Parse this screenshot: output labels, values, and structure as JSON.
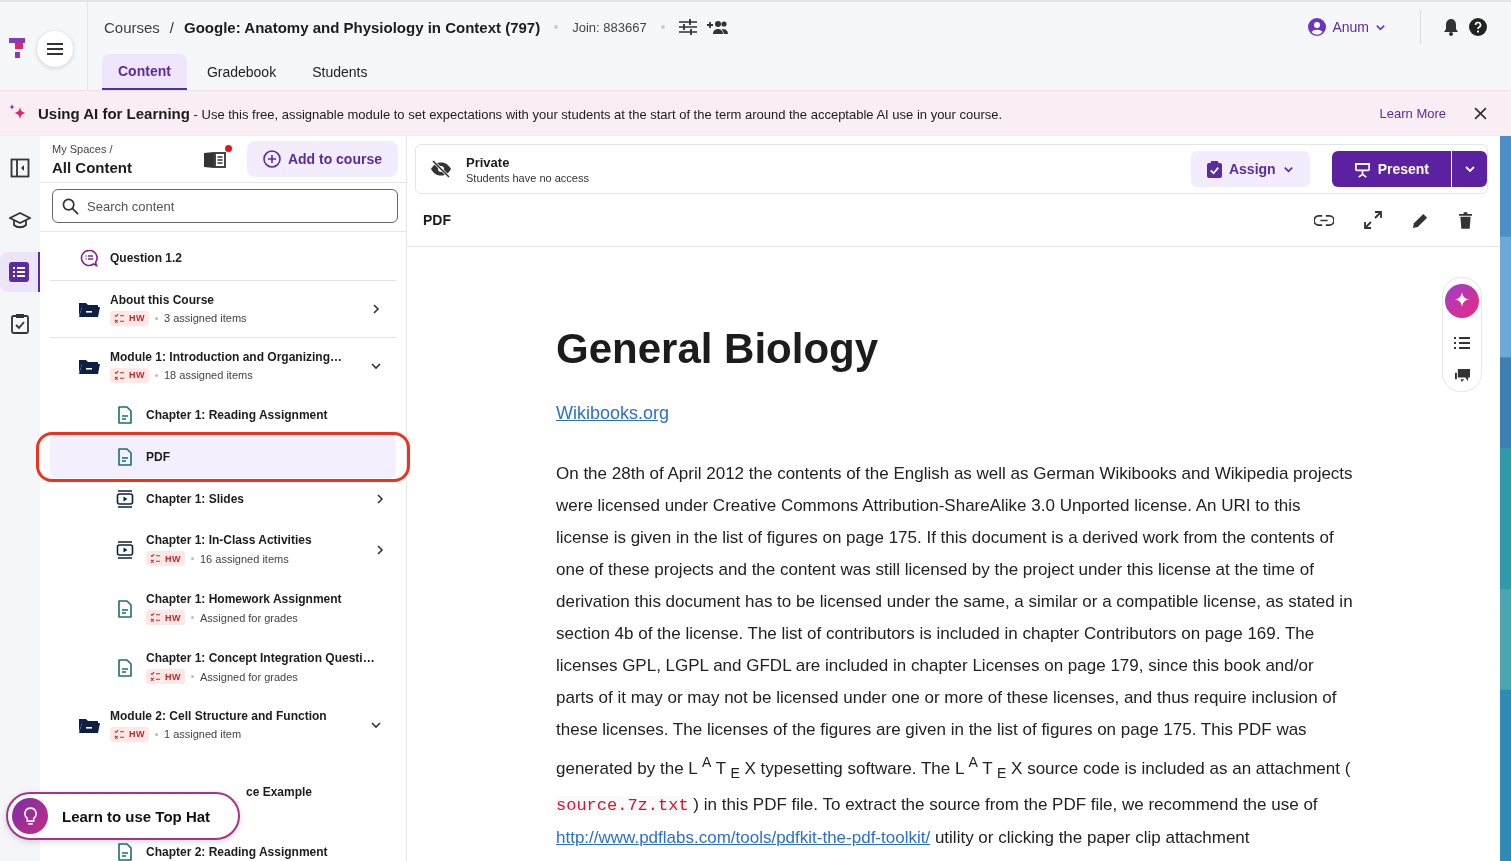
{
  "course": {
    "parent": "Courses",
    "separator": "/",
    "title": "Google: Anatomy and Physiology in Context (797)",
    "join": "Join: 883667"
  },
  "user": {
    "name": "Anum"
  },
  "tabs": [
    {
      "label": "Content",
      "selected": true
    },
    {
      "label": "Gradebook",
      "selected": false
    },
    {
      "label": "Students",
      "selected": false
    }
  ],
  "banner": {
    "title": "Using AI for Learning",
    "text": "- Use this free, assignable module to set expectations with your students at the start of the term around the acceptable AI use in your course.",
    "link": "Learn More"
  },
  "rail": [
    {
      "kind": "collapse",
      "selected": false
    },
    {
      "kind": "course",
      "selected": false
    },
    {
      "kind": "content",
      "selected": true
    },
    {
      "kind": "assign",
      "selected": false
    }
  ],
  "sidebar": {
    "crumb": "My Spaces /",
    "title": "All Content",
    "notification": true,
    "add_button": "Add to course",
    "search": {
      "placeholder": "Search content"
    },
    "items": [
      {
        "kind": "question",
        "title": "Question 1.2",
        "selected": false,
        "annotated": false
      },
      {
        "kind": "folder",
        "title": "About this Course",
        "badge": "HW",
        "meta": "3 assigned items",
        "expanded": false,
        "selected": false,
        "annotated": false
      },
      {
        "kind": "folder",
        "title": "Module 1: Introduction and Organizing…",
        "badge": "HW",
        "meta": "18 assigned items",
        "expanded": true,
        "selected": false,
        "annotated": false,
        "children": [
          {
            "kind": "doc",
            "title": "Chapter 1: Reading Assignment",
            "selected": false,
            "annotated": false
          },
          {
            "kind": "doc",
            "title": "PDF",
            "selected": true,
            "annotated": true
          },
          {
            "kind": "slides",
            "title": "Chapter 1: Slides",
            "expanded": false,
            "selected": false,
            "annotated": false
          },
          {
            "kind": "slides",
            "title": "Chapter 1: In-Class Activities",
            "badge": "HW",
            "meta": "16 assigned items",
            "expanded": false,
            "selected": false,
            "annotated": false
          },
          {
            "kind": "doc",
            "title": "Chapter 1: Homework Assignment",
            "badge": "HW",
            "meta": "Assigned for grades",
            "selected": false,
            "annotated": false
          },
          {
            "kind": "doc",
            "title": "Chapter 1: Concept Integration Questi…",
            "badge": "HW",
            "meta": "Assigned for grades",
            "selected": false,
            "annotated": false
          }
        ]
      },
      {
        "kind": "folder",
        "title": "Module 2: Cell Structure and Function",
        "badge": "HW",
        "meta": "1 assigned item",
        "expanded": true,
        "selected": false,
        "annotated": false,
        "children": [
          {
            "title": "ce Example",
            "covered": true,
            "selected": false,
            "annotated": false
          },
          {
            "kind": "doc",
            "title": "Chapter 2: Reading Assignment",
            "selected": false,
            "annotated": false
          }
        ]
      }
    ]
  },
  "visibility": {
    "title": "Private",
    "subtitle": "Students have no access"
  },
  "assign_button": "Assign",
  "present_button": "Present",
  "document_header": "PDF",
  "document": {
    "title": "General Biology",
    "source_link": "Wikibooks.org",
    "paragraph": "On the 28th of April 2012 the contents of the English as well as German Wikibooks and Wikipedia projects were licensed under Creative Commons Attribution-ShareAlike 3.0 Unported license. An URI to this license is given in the list of figures on page 175. If this document is a derived work from the contents of one of these projects and the content was still licensed by the project under this license at the time of derivation this document has to be licensed under the same, a similar or a compatible license, as stated in section 4b of the license. The list of contributors is included in chapter Contributors on page 169. The licenses GPL, LGPL and GFDL are included in chapter Licenses on page 179, since this book and/or parts of it may or may not be licensed under one or more of these licenses, and thus require inclusion of these licenses. The licenses of the figures are given in the list of figures on page 175. This PDF was generated by the L $^{A}$ T $_{E}$ X typesetting software. The L $^{A}$ T $_{E}$ X source code is included as an attachment (",
    "file": "source.7z.txt",
    "after_file": ") in this PDF file. To extract the source from the PDF file, we recommend the use of",
    "link": "http://www.pdflabs.com/tools/pdfkit-the-pdf-toolkit/",
    "after_link": "utility or clicking the paper clip attachment"
  },
  "help_button": "Learn to use Top Hat"
}
